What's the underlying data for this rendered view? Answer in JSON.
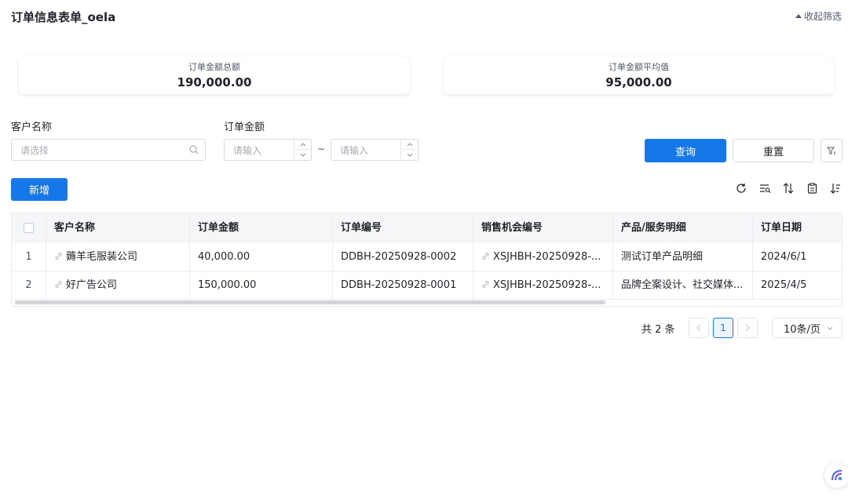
{
  "header": {
    "title": "订单信息表单_oela",
    "collapse_label": "收起筛选"
  },
  "stats": [
    {
      "label": "订单金额总额",
      "value": "190,000.00"
    },
    {
      "label": "订单金额平均值",
      "value": "95,000.00"
    }
  ],
  "filters": {
    "customer_label": "客户名称",
    "customer_placeholder": "请选择",
    "amount_label": "订单金额",
    "amount_min_placeholder": "请输入",
    "amount_max_placeholder": "请输入",
    "range_separator": "~",
    "query_label": "查询",
    "reset_label": "重置"
  },
  "actions": {
    "add_label": "新增"
  },
  "table": {
    "columns": [
      "客户名称",
      "订单金额",
      "订单编号",
      "销售机会编号",
      "产品/服务明细",
      "订单日期"
    ],
    "rows": [
      {
        "index": "1",
        "customer": "薅羊毛服装公司",
        "amount": "40,000.00",
        "order_no": "DDBH-20250928-0002",
        "opp_no": "XSJHBH-20250928-...",
        "detail": "测试订单产品明细",
        "date": "2024/6/1"
      },
      {
        "index": "2",
        "customer": "好广告公司",
        "amount": "150,000.00",
        "order_no": "DDBH-20250928-0001",
        "opp_no": "XSJHBH-20250928-...",
        "detail": "品牌全案设计、社交媒体...",
        "date": "2025/4/5"
      }
    ]
  },
  "pagination": {
    "total_label": "共 2 条",
    "current_page": "1",
    "page_size_label": "10条/页"
  },
  "colors": {
    "primary": "#1677e8",
    "border": "#d9dce2"
  },
  "icons": [
    "search-icon",
    "refresh-icon",
    "density-icon",
    "sort-icon",
    "clipboard-icon",
    "order-icon",
    "filter-icon",
    "link-icon"
  ]
}
